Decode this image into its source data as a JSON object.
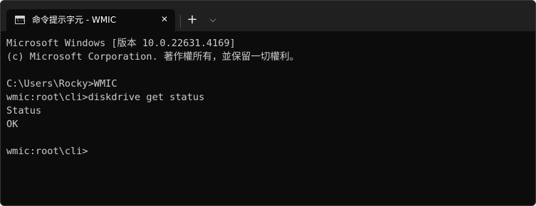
{
  "tab": {
    "icon": "command-prompt-icon",
    "icon_text": "C:\\",
    "title": "命令提示字元 - WMIC",
    "close_glyph": "✕"
  },
  "toolbar": {
    "new_tab_glyph": "+",
    "dropdown_glyph": "⌵"
  },
  "terminal": {
    "lines": [
      "Microsoft Windows [版本 10.0.22631.4169]",
      "(c) Microsoft Corporation. 著作權所有，並保留一切權利。",
      "",
      "C:\\Users\\Rocky>WMIC",
      "wmic:root\\cli>diskdrive get status",
      "Status",
      "OK",
      "",
      "wmic:root\\cli>"
    ]
  },
  "colors": {
    "titlebar_bg": "#202020",
    "terminal_bg": "#0c0c0c",
    "terminal_fg": "#cccccc"
  }
}
